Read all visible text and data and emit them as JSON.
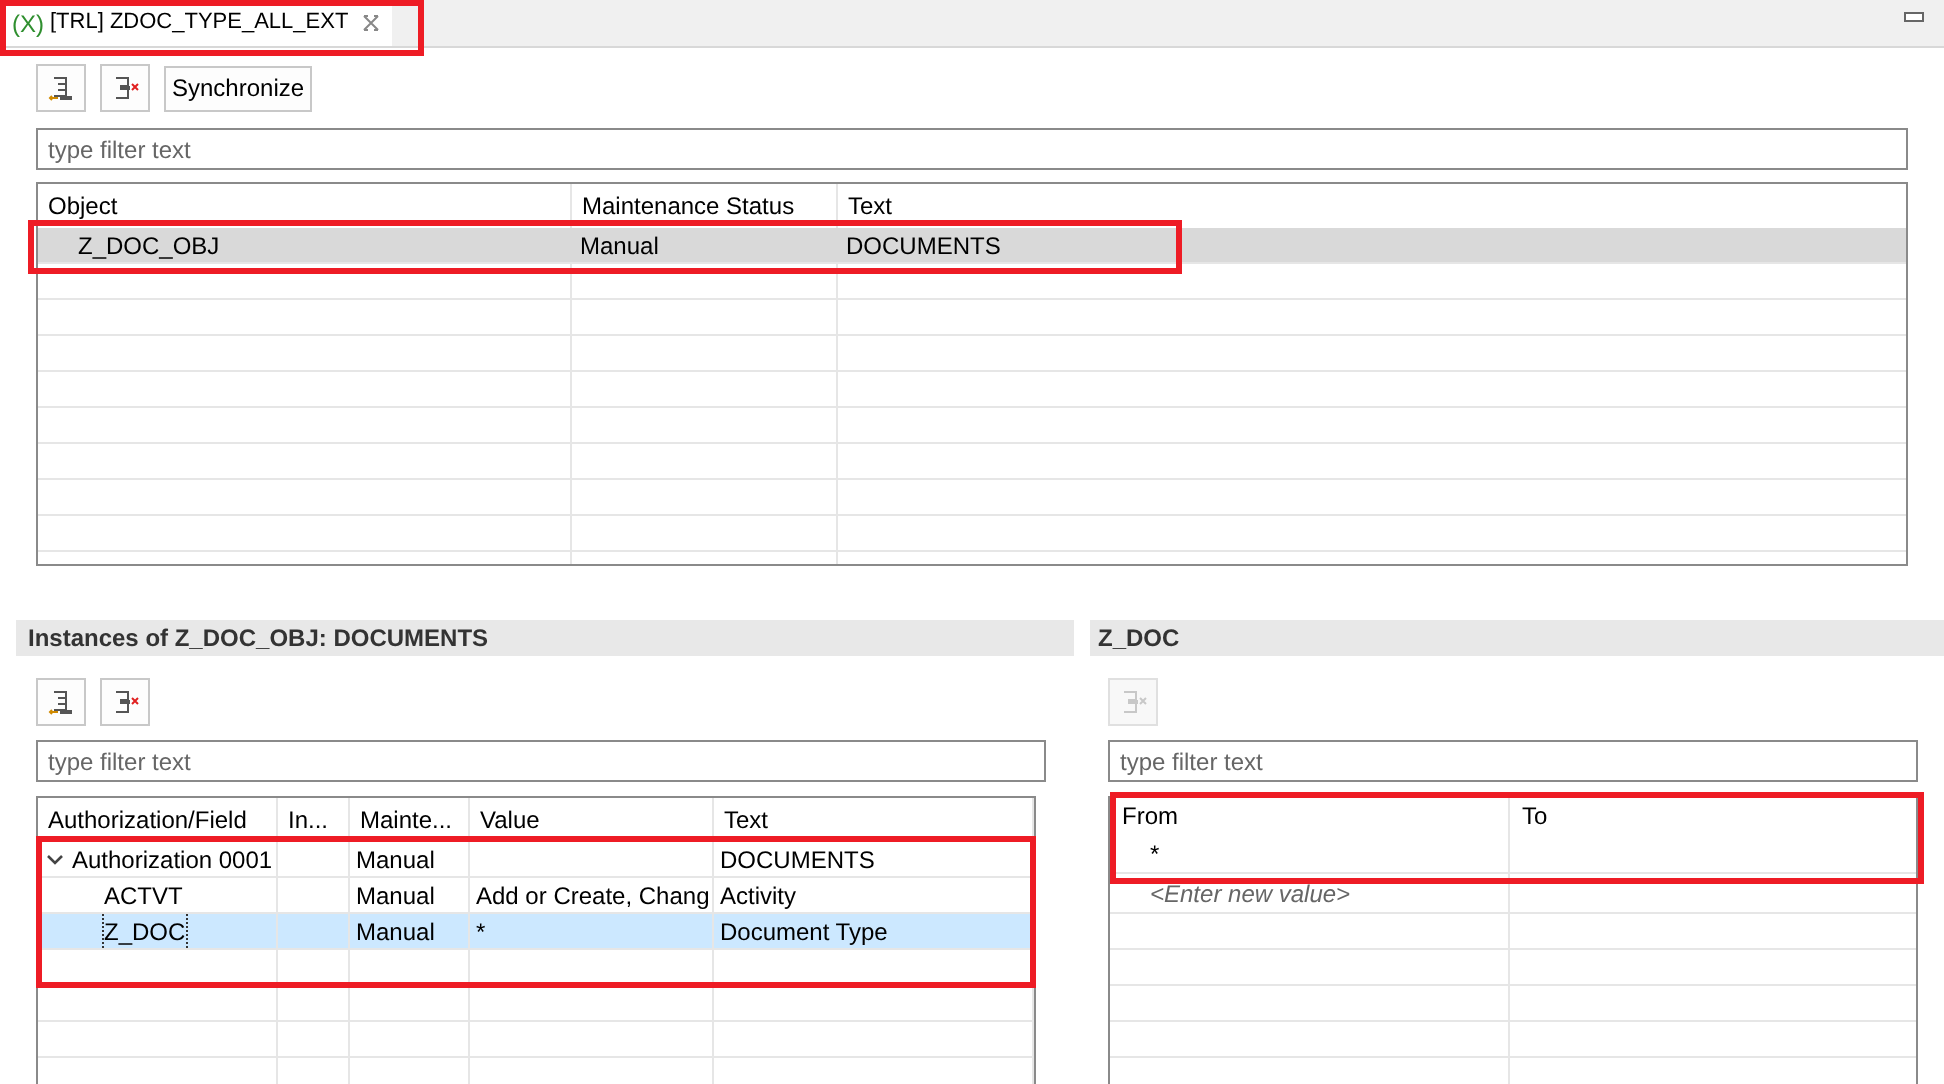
{
  "tab": {
    "icon_text": "(X)",
    "title": "[TRL] ZDOC_TYPE_ALL_EXT",
    "selected": true
  },
  "top": {
    "toolbar": [
      {
        "kind": "add",
        "disabled": false
      },
      {
        "kind": "remove",
        "disabled": false
      },
      {
        "kind": "text",
        "label": "Synchronize",
        "disabled": false
      }
    ],
    "filter": {
      "placeholder": "type filter text"
    },
    "columns": [
      "Object",
      "Maintenance Status",
      "Text"
    ],
    "rows": [
      {
        "cells": [
          "Z_DOC_OBJ",
          "Manual",
          "DOCUMENTS"
        ],
        "selected": true
      }
    ]
  },
  "instances": {
    "title": "Instances of Z_DOC_OBJ: DOCUMENTS",
    "toolbar": [
      {
        "kind": "add",
        "disabled": false
      },
      {
        "kind": "remove",
        "disabled": false
      }
    ],
    "filter": {
      "placeholder": "type filter text"
    },
    "columns": [
      "Authorization/Field",
      "In...",
      "Mainte...",
      "Value",
      "Text"
    ],
    "rows": [
      {
        "cells": [
          "Authorization 0001",
          "",
          "Manual",
          "",
          "DOCUMENTS"
        ],
        "expanded": true,
        "selected": false,
        "children": [
          {
            "cells": [
              "ACTVT",
              "",
              "Manual",
              "Add or Create, Chang",
              "Activity"
            ],
            "selected": false
          },
          {
            "cells": [
              "Z_DOC",
              "",
              "Manual",
              "*",
              "Document Type"
            ],
            "selected": true
          }
        ]
      }
    ]
  },
  "values": {
    "title": "Z_DOC",
    "toolbar": [
      {
        "kind": "remove",
        "disabled": true
      }
    ],
    "filter": {
      "placeholder": "type filter text"
    },
    "columns": [
      "From",
      "To"
    ],
    "rows": [
      {
        "kind": "value",
        "cells": [
          "*",
          ""
        ]
      },
      {
        "kind": "new",
        "cells": [
          "<Enter new value>",
          ""
        ]
      }
    ]
  }
}
